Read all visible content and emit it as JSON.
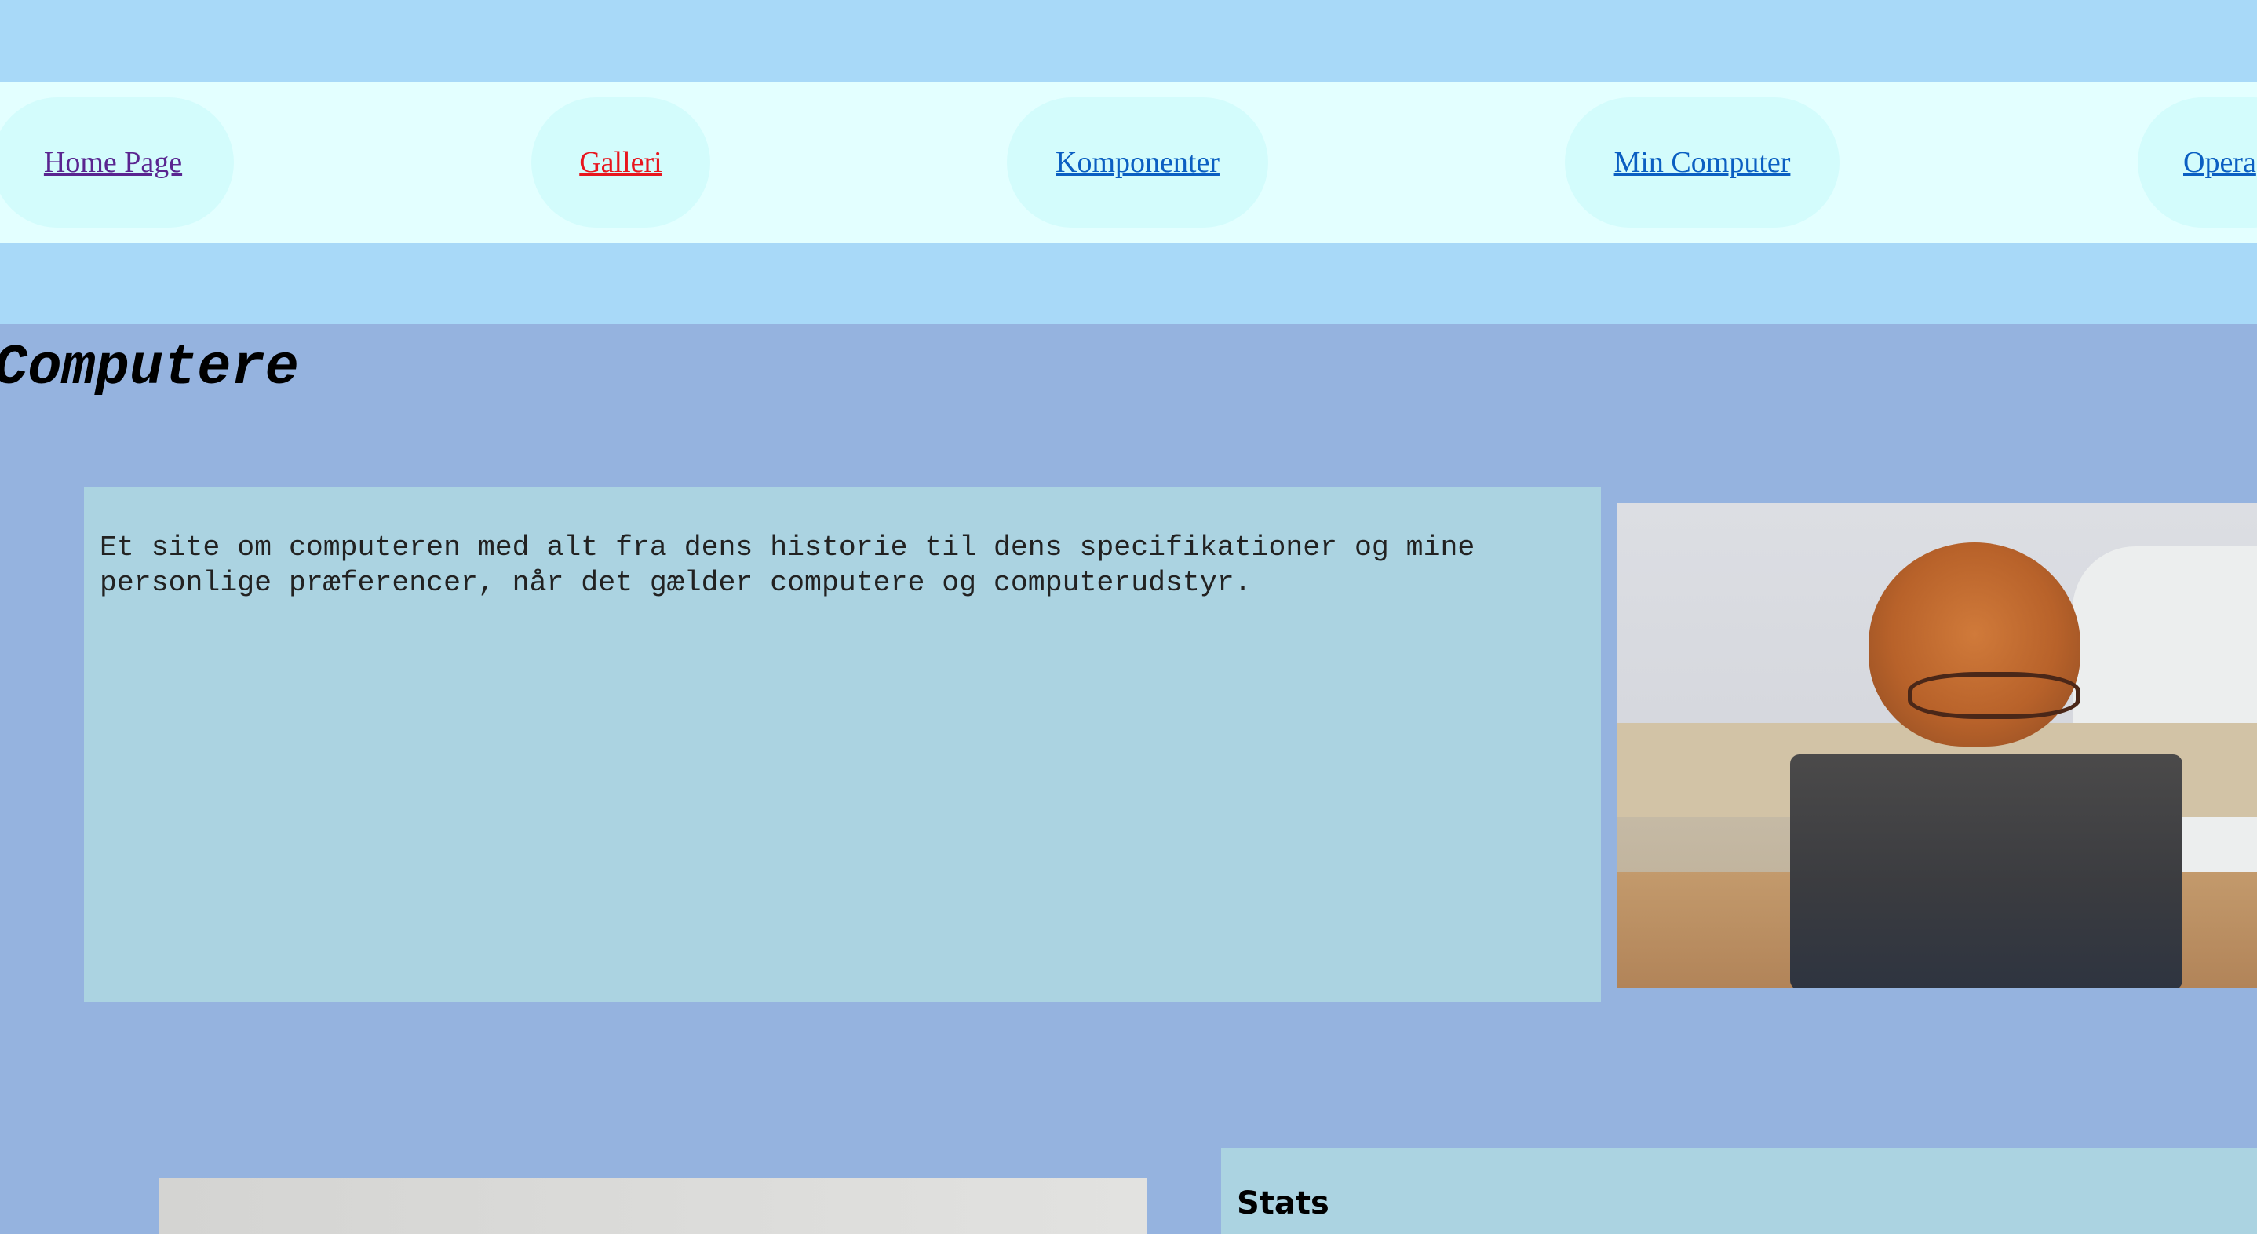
{
  "nav": {
    "items": [
      {
        "label": "Home Page",
        "state": "visited"
      },
      {
        "label": "Galleri",
        "state": "active"
      },
      {
        "label": "Komponenter",
        "state": "link"
      },
      {
        "label": "Min Computer",
        "state": "link"
      },
      {
        "label": "Opera",
        "state": "link"
      }
    ]
  },
  "page": {
    "title": "Computere",
    "intro": "Et site om computeren med alt fra dens historie til dens specifikationer og mine personlige præferencer, når det gælder computere og computerudstyr."
  },
  "stats": {
    "title": "Stats"
  },
  "colors": {
    "page_bg": "#95b3df",
    "header_band": "#a8d9f8",
    "nav_bar": "#e3ffff",
    "nav_pill": "#d3fcfc",
    "link": "#0b5fc2",
    "link_visited": "#5a2590",
    "link_active": "#e8161e",
    "content_box": "#abd3e1"
  }
}
